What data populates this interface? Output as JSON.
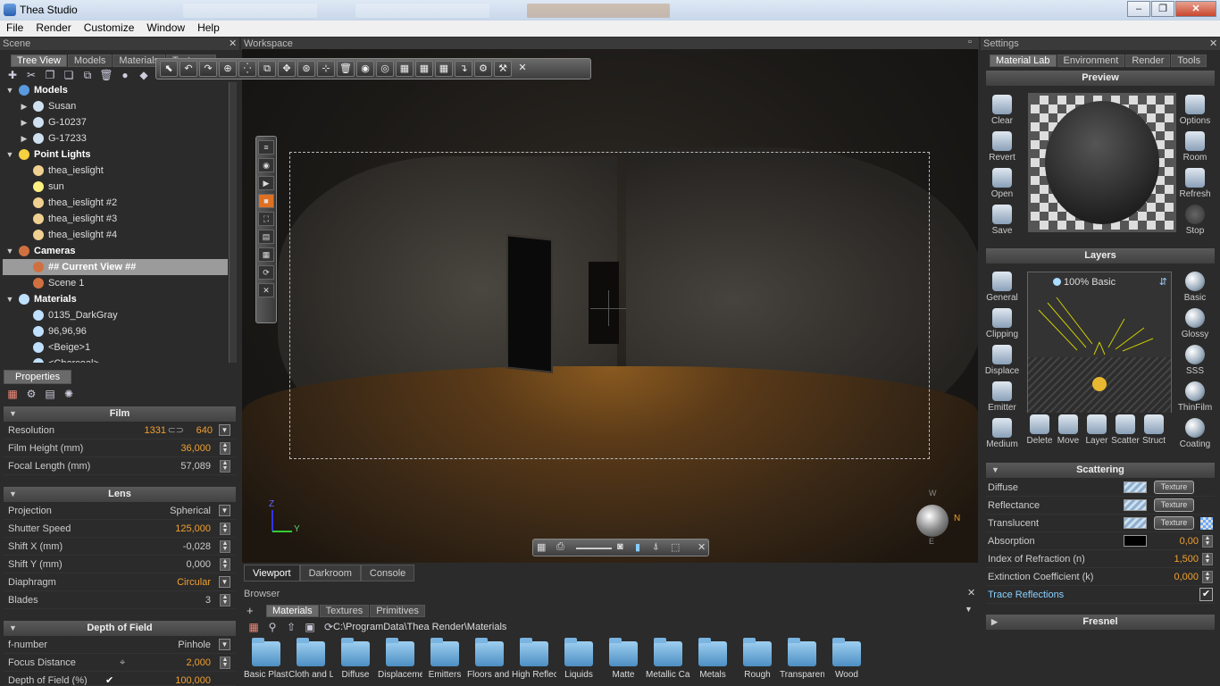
{
  "window": {
    "title": "Thea Studio",
    "minimize": "‒",
    "maximize": "❐",
    "close": "✕"
  },
  "menu": [
    "File",
    "Render",
    "Customize",
    "Window",
    "Help"
  ],
  "scene": {
    "panel_title": "Scene",
    "tabs": [
      "Tree View",
      "Models",
      "Materials",
      "Textures"
    ],
    "tree": [
      {
        "label": "Models",
        "level": 0,
        "group": true,
        "toggle": "▼",
        "icon": "cube-icon"
      },
      {
        "label": "Susan",
        "level": 1,
        "toggle": "▶",
        "icon": "model-icon"
      },
      {
        "label": "G-10237",
        "level": 1,
        "toggle": "▶",
        "icon": "model-icon"
      },
      {
        "label": "G-17233",
        "level": 1,
        "toggle": "▶",
        "icon": "model-icon"
      },
      {
        "label": "Point Lights",
        "level": 0,
        "group": true,
        "toggle": "▼",
        "icon": "bulb-icon"
      },
      {
        "label": "thea_ieslight",
        "level": 1,
        "icon": "cone-light-icon"
      },
      {
        "label": "sun",
        "level": 1,
        "icon": "sun-icon"
      },
      {
        "label": "thea_ieslight #2",
        "level": 1,
        "icon": "cone-light-icon"
      },
      {
        "label": "thea_ieslight #3",
        "level": 1,
        "icon": "cone-light-icon"
      },
      {
        "label": "thea_ieslight #4",
        "level": 1,
        "icon": "cone-light-icon"
      },
      {
        "label": "Cameras",
        "level": 0,
        "group": true,
        "toggle": "▼",
        "icon": "camera-icon"
      },
      {
        "label": "## Current View ##",
        "level": 1,
        "icon": "camera-icon",
        "selected": true
      },
      {
        "label": "Scene 1",
        "level": 1,
        "icon": "camera-icon"
      },
      {
        "label": "Materials",
        "level": 0,
        "group": true,
        "toggle": "▼",
        "icon": "sphere-icon"
      },
      {
        "label": "0135_DarkGray",
        "level": 1,
        "icon": "sphere-icon"
      },
      {
        "label": "96,96,96",
        "level": 1,
        "icon": "sphere-icon"
      },
      {
        "label": "<Beige>1",
        "level": 1,
        "icon": "sphere-icon"
      },
      {
        "label": "<Charcoal>",
        "level": 1,
        "icon": "sphere-icon"
      }
    ]
  },
  "properties": {
    "tab": "Properties",
    "film": {
      "title": "Film",
      "resolution_label": "Resolution",
      "res_w": "1331",
      "res_h": "640",
      "height_label": "Film Height (mm)",
      "height": "36,000",
      "focal_label": "Focal Length (mm)",
      "focal": "57,089"
    },
    "lens": {
      "title": "Lens",
      "projection_label": "Projection",
      "projection": "Spherical",
      "shutter_label": "Shutter Speed",
      "shutter": "125,000",
      "shiftx_label": "Shift X (mm)",
      "shiftx": "-0,028",
      "shifty_label": "Shift Y (mm)",
      "shifty": "0,000",
      "diaphragm_label": "Diaphragm",
      "diaphragm": "Circular",
      "blades_label": "Blades",
      "blades": "3"
    },
    "dof": {
      "title": "Depth of Field",
      "fnumber_label": "f-number",
      "fnumber": "Pinhole",
      "focus_label": "Focus Distance",
      "focus": "2,000",
      "dofp_label": "Depth of Field (%)",
      "dofp": "100,000"
    }
  },
  "workspace": {
    "title": "Workspace",
    "tabs": [
      "Viewport",
      "Darkroom",
      "Console"
    ],
    "axis_z": "Z",
    "axis_y": "Y",
    "compass_n": "N",
    "compass_w": "W",
    "compass_e": "E"
  },
  "browser": {
    "title": "Browser",
    "tabs": [
      "Materials",
      "Textures",
      "Primitives"
    ],
    "path": "C:\\ProgramData\\Thea Render\\Materials",
    "folders": [
      "Basic Plastic",
      "Cloth and L",
      "Diffuse",
      "Displaceme",
      "Emitters",
      "Floors and T",
      "High Reflect",
      "Liquids",
      "Matte",
      "Metallic Car",
      "Metals",
      "Rough",
      "Transparent",
      "Wood"
    ]
  },
  "settings": {
    "title": "Settings",
    "tabs": [
      "Material Lab",
      "Environment",
      "Render",
      "Tools"
    ],
    "preview_title": "Preview",
    "preview_left": [
      "Clear",
      "Revert",
      "Open",
      "Save"
    ],
    "preview_right": [
      "Options",
      "Room",
      "Refresh",
      "Stop"
    ],
    "layers_title": "Layers",
    "layer_name": "100% Basic",
    "layer_left": [
      "General",
      "Clipping",
      "Displace",
      "Emitter",
      "Medium"
    ],
    "layer_right": [
      "Basic",
      "Glossy",
      "SSS",
      "ThinFilm",
      "Coating"
    ],
    "layer_bottom": [
      "Delete",
      "Move",
      "Layer",
      "Scatter",
      "Struct"
    ],
    "scattering_title": "Scattering",
    "texture_label": "Texture",
    "rows": {
      "diffuse": "Diffuse",
      "reflectance": "Reflectance",
      "translucent": "Translucent",
      "absorption": "Absorption",
      "absorption_val": "0,00",
      "ior": "Index of Refraction (n)",
      "ior_val": "1,500",
      "ext": "Extinction Coefficient (k)",
      "ext_val": "0,000",
      "trace": "Trace Reflections"
    },
    "fresnel_title": "Fresnel"
  }
}
